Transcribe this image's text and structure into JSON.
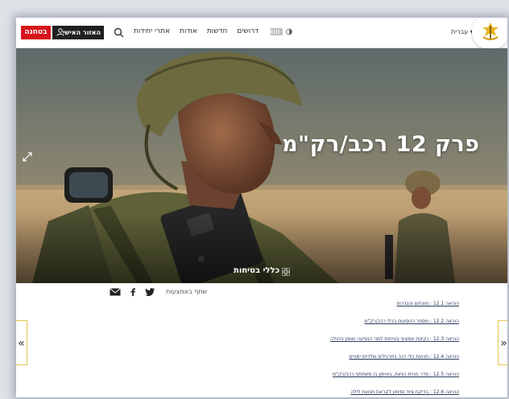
{
  "header": {
    "badge_label": "בטחנה",
    "personal_area_label": "האזור האישי",
    "nav_items": [
      "דרושים",
      "חדשות",
      "אודות",
      "אתרי יחידות"
    ],
    "language_label": "עברית ▾"
  },
  "hero": {
    "title": "פרק 12 רכב/רק\"מ",
    "tag_label": "כללי בטיחות"
  },
  "share": {
    "label": "שתף באמצעות"
  },
  "links": [
    "הוראה 12.1 : מונחים והגדרות",
    "הוראה 12.2 : מספר הנוסעים בכלי רכב/רק\"מ",
    "הוראה 12.3 : נקיטת אמצעי בטיחות למני הנסיעה ואופן ניהולה",
    "הוראה 12.4 : תנועת כלי רכב בתרגילים שלדיים ימניים",
    "הוראה 12.5 : סדר חניית כוחות, באימון בו משתתף רכב/רק\"מ",
    "הוראה 12.6 : בדיקת ציוד וסימון לקראת תנועת לילה"
  ],
  "carousel": {
    "prev_label": "«",
    "next_label": "»"
  },
  "colors": {
    "badge_red": "#d7141b",
    "dark_button": "#202020",
    "link": "#2a3a5c",
    "arrow_border": "#e8c44a"
  }
}
